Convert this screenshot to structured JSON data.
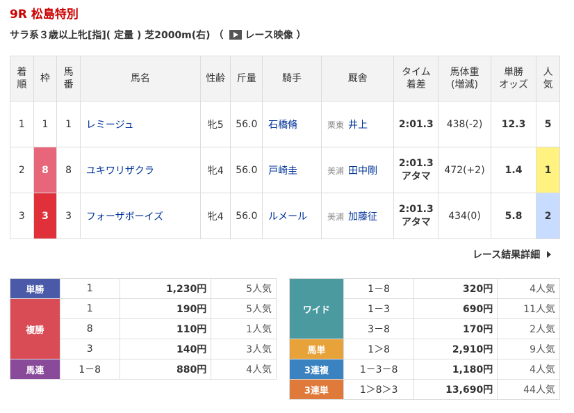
{
  "race": {
    "title": "9R 松島特別",
    "conditions": "サラ系３歳以上牝[指]( 定量 ) 芝2000m(右) （",
    "video_label": "レース映像",
    "close_paren": "）"
  },
  "table": {
    "headers": {
      "rank": [
        "着",
        "順"
      ],
      "frame": "枠",
      "num": [
        "馬",
        "番"
      ],
      "name": "馬名",
      "sexage": "性齢",
      "weight": "斤量",
      "jockey": "騎手",
      "stable": "厩舎",
      "time": [
        "タイム",
        "着差"
      ],
      "bodyweight": [
        "馬体重",
        "(増減)"
      ],
      "odds": [
        "単勝",
        "オッズ"
      ],
      "popularity": [
        "人",
        "気"
      ]
    },
    "rows": [
      {
        "rank": "1",
        "frame": "1",
        "num": "1",
        "name": "レミージュ",
        "sexage": "牝5",
        "weight": "56.0",
        "jockey": "石橋脩",
        "region": "栗東",
        "trainer": "井上",
        "time": "2:01.3",
        "margin": "",
        "bodyweight": "438(-2)",
        "odds": "12.3",
        "pop": "5"
      },
      {
        "rank": "2",
        "frame": "8",
        "num": "8",
        "name": "ユキワリザクラ",
        "sexage": "牝4",
        "weight": "56.0",
        "jockey": "戸崎圭",
        "region": "美浦",
        "trainer": "田中剛",
        "time": "2:01.3",
        "margin": "アタマ",
        "bodyweight": "472(+2)",
        "odds": "1.4",
        "pop": "1"
      },
      {
        "rank": "3",
        "frame": "3",
        "num": "3",
        "name": "フォーザボーイズ",
        "sexage": "牝4",
        "weight": "56.0",
        "jockey": "ルメール",
        "region": "美浦",
        "trainer": "加藤征",
        "time": "2:01.3",
        "margin": "アタマ",
        "bodyweight": "434(0)",
        "odds": "5.8",
        "pop": "2"
      }
    ]
  },
  "more_label": "レース結果詳細",
  "payout_left": {
    "tansho": {
      "label": "単勝",
      "rows": [
        {
          "num": "1",
          "amt": "1,230円",
          "pop": "5人気"
        }
      ]
    },
    "fukusho": {
      "label": "複勝",
      "rows": [
        {
          "num": "1",
          "amt": "190円",
          "pop": "5人気"
        },
        {
          "num": "8",
          "amt": "110円",
          "pop": "1人気"
        },
        {
          "num": "3",
          "amt": "140円",
          "pop": "3人気"
        }
      ]
    },
    "umaren": {
      "label": "馬連",
      "rows": [
        {
          "num": "1－8",
          "amt": "880円",
          "pop": "4人気"
        }
      ]
    }
  },
  "payout_right": {
    "wide": {
      "label": "ワイド",
      "rows": [
        {
          "num": "1－8",
          "amt": "320円",
          "pop": "4人気"
        },
        {
          "num": "1－3",
          "amt": "690円",
          "pop": "11人気"
        },
        {
          "num": "3－8",
          "amt": "170円",
          "pop": "2人気"
        }
      ]
    },
    "umatan": {
      "label": "馬単",
      "rows": [
        {
          "num": "1＞8",
          "amt": "2,910円",
          "pop": "9人気"
        }
      ]
    },
    "sanrenpuku": {
      "label": "3連複",
      "rows": [
        {
          "num": "1－3－8",
          "amt": "1,180円",
          "pop": "4人気"
        }
      ]
    },
    "sanrentan": {
      "label": "3連単",
      "rows": [
        {
          "num": "1＞8＞3",
          "amt": "13,690円",
          "pop": "44人気"
        }
      ]
    }
  },
  "colors": {
    "title": "#cc0000",
    "link": "#003399",
    "frame8": "#e8667a",
    "frame3": "#e0303a",
    "pop1": "#fff280",
    "pop2": "#c7dcff"
  }
}
